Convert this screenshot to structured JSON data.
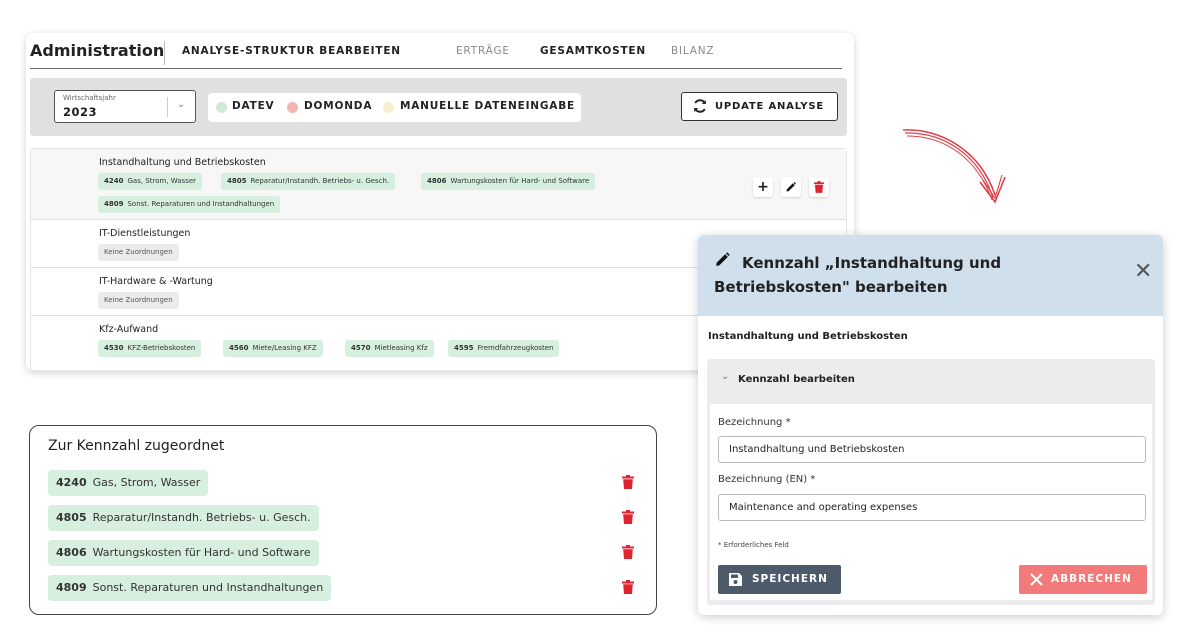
{
  "header": {
    "title": "Administration",
    "nav": {
      "analyse_struktur": "ANALYSE-STRUKTUR BEARBEITEN",
      "ertraege": "ERTRÄGE",
      "gesamtkosten": "GESAMTKOSTEN",
      "bilanz": "BILANZ"
    }
  },
  "filters": {
    "year_label": "Wirtschaftsjahr",
    "year_value": "2023",
    "legend": [
      {
        "label": "DATEV",
        "color": "#cfe9d7"
      },
      {
        "label": "DOMONDA",
        "color": "#f2b5b5"
      },
      {
        "label": "MANUELLE DATENEINGABE",
        "color": "#f6efcf"
      }
    ],
    "update_label": "UPDATE ANALYSE"
  },
  "rows": [
    {
      "name": "Instandhaltung und Betriebskosten",
      "chips": [
        {
          "code": "4240",
          "label": "Gas, Strom, Wasser"
        },
        {
          "code": "4805",
          "label": "Reparatur/Instandh. Betriebs- u. Gesch."
        },
        {
          "code": "4806",
          "label": "Wartungskosten für Hard- und Software"
        },
        {
          "code": "4809",
          "label": "Sonst. Reparaturen und Instandhaltungen"
        }
      ],
      "actions": {
        "add": "+"
      }
    },
    {
      "name": "IT-Dienstleistungen",
      "empty_label": "Keine Zuordnungen"
    },
    {
      "name": "IT-Hardware & -Wartung",
      "empty_label": "Keine Zuordnungen"
    },
    {
      "name": "Kfz-Aufwand",
      "chips": [
        {
          "code": "4530",
          "label": "KFZ-Betriebskosten"
        },
        {
          "code": "4560",
          "label": "Miete/Leasing KFZ"
        },
        {
          "code": "4570",
          "label": "Mietleasing Kfz"
        },
        {
          "code": "4595",
          "label": "Fremdfahrzeugkosten"
        }
      ]
    }
  ],
  "assigned": {
    "title": "Zur Kennzahl zugeordnet",
    "items": [
      {
        "code": "4240",
        "label": "Gas, Strom, Wasser"
      },
      {
        "code": "4805",
        "label": "Reparatur/Instandh. Betriebs- u. Gesch."
      },
      {
        "code": "4806",
        "label": "Wartungskosten für Hard- und Software"
      },
      {
        "code": "4809",
        "label": "Sonst. Reparaturen und Instandhaltungen"
      }
    ]
  },
  "modal": {
    "title": "Kennzahl „Instandhaltung und Betriebskosten\" bearbeiten",
    "subtitle": "Instandhaltung und Betriebskosten",
    "accordion_label": "Kennzahl bearbeiten",
    "field1_label": "Bezeichnung *",
    "field1_value": "Instandhaltung und Betriebskosten",
    "field2_label": "Bezeichnung (EN) *",
    "field2_value": "Maintenance and operating expenses",
    "note": "* Erforderliches Feld",
    "save_label": "SPEICHERN",
    "cancel_label": "ABBRECHEN"
  },
  "colors": {
    "chip": "#d6efdf",
    "modal_header": "#cfe0ec",
    "delete": "#e0242f",
    "save": "#4c5a6a",
    "cancel": "#f27a7a",
    "arrow": "#e0404a"
  }
}
